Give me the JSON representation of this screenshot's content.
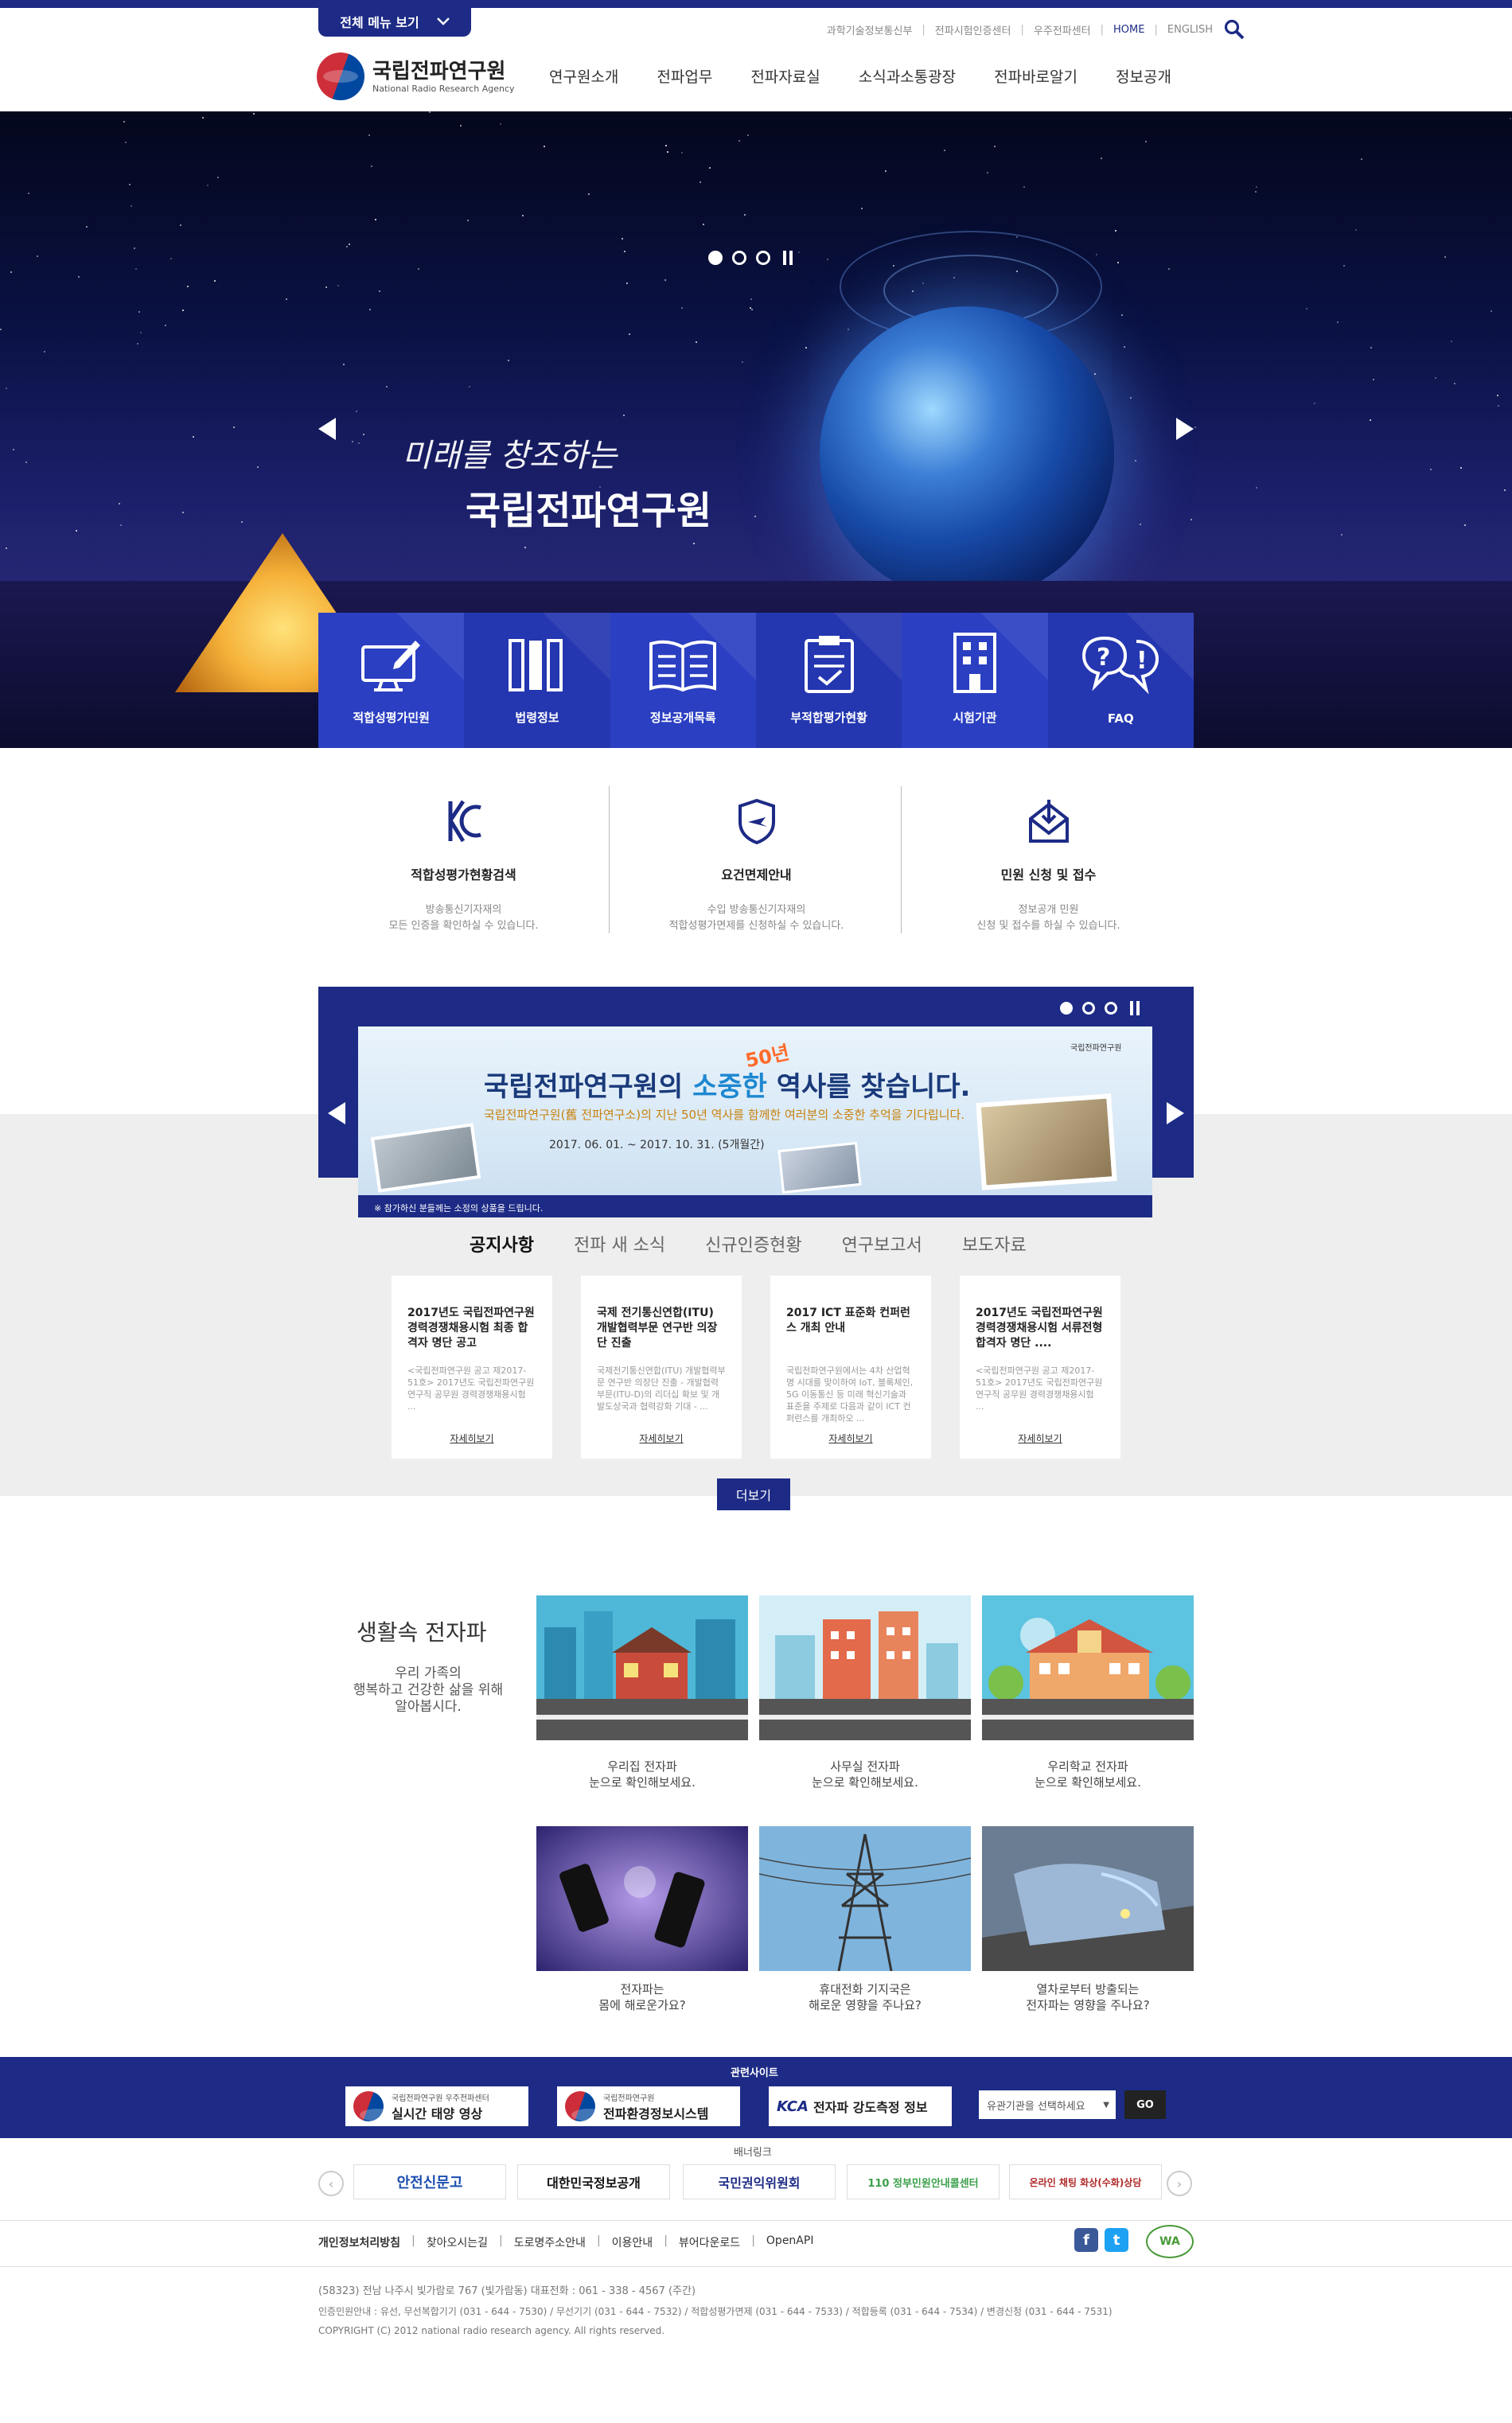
{
  "header": {
    "all_menu": "전체 메뉴 보기",
    "util_links": [
      "과학기술정보통신부",
      "전파시험인증센터",
      "우주전파센터",
      "HOME",
      "ENGLISH"
    ],
    "logo_ko": "국립전파연구원",
    "logo_en": "National Radio Research Agency",
    "gnb": [
      "연구원소개",
      "전파업무",
      "전파자료실",
      "소식과소통광장",
      "전파바로알기",
      "정보공개"
    ]
  },
  "hero": {
    "subtitle": "미래를 창조하는",
    "title": "국립전파연구원",
    "slides": 3,
    "active_slide": 1
  },
  "quick_links": [
    {
      "label": "적합성평가민원",
      "icon": "monitor-pen-icon",
      "color": "#2b3fc2"
    },
    {
      "label": "법령정보",
      "icon": "books-icon",
      "color": "#2436b0"
    },
    {
      "label": "정보공개목록",
      "icon": "open-book-icon",
      "color": "#2b3fc2"
    },
    {
      "label": "부적합평가현황",
      "icon": "clipboard-check-icon",
      "color": "#2436b0"
    },
    {
      "label": "시험기관",
      "icon": "building-icon",
      "color": "#2b3fc2"
    },
    {
      "label": "FAQ",
      "icon": "speech-bubbles-icon",
      "color": "#2436b0"
    }
  ],
  "services": [
    {
      "title": "적합성평가현황검색",
      "desc1": "방송통신기자재의",
      "desc2": "모든 인증을 확인하실 수 있습니다.",
      "icon": "kc-mark-icon"
    },
    {
      "title": "요건면제안내",
      "desc1": "수입 방송통신기자재의",
      "desc2": "적합성평가면제를 신청하실 수 있습니다.",
      "icon": "shield-plane-icon"
    },
    {
      "title": "민원 신청 및 접수",
      "desc1": "정보공개 민원",
      "desc2": "신청 및 접수를 하실 수 있습니다.",
      "icon": "mail-download-icon"
    }
  ],
  "banner": {
    "title_a": "국립전파연구원의 ",
    "title_hl": "소중한",
    "title_b": " 역사를 찾습니다.",
    "badge": "50년",
    "desc": "국립전파연구원(舊 전파연구소)의 지난 50년 역사를 함께한 여러분의 소중한 추억을 기다립니다.",
    "date": "2017. 06. 01. ~ 2017. 10. 31. (5개월간)",
    "note": "※ 참가하신 분들께는 소정의 상품을 드립니다.",
    "org": "국립전파연구원"
  },
  "notice": {
    "tabs": [
      "공지사항",
      "전파 새 소식",
      "신규인증현황",
      "연구보고서",
      "보도자료"
    ],
    "active_tab": 0,
    "cards": [
      {
        "title": "2017년도 국립전파연구원 경력경쟁채용시험 최종 합격자 명단 공고",
        "body": "<국립전파연구원 공고 제2017-51호> 2017년도 국립전파연구원 연구직 공무원 경력경쟁채용시험 ...",
        "more": "자세히보기"
      },
      {
        "title": "국제 전기통신연합(ITU) 개발협력부문 연구반 의장단 진출",
        "body": "국제전기통신연합(ITU) 개발협력부문 연구반 의장단 진출 - 개발협력부문(ITU-D)의 리더십 확보 및 개발도상국과 협력강화 기대 - ...",
        "more": "자세히보기"
      },
      {
        "title": "2017 ICT 표준화 컨퍼런스 개최 안내",
        "body": "국립전파연구원에서는 4차 산업혁명 시대를 맞이하여 IoT, 블록체인, 5G 이동통신 등 미래 혁신기술과 표준을 주제로 다음과 같이 ICT 컨퍼런스를 개최하오 ...",
        "more": "자세히보기"
      },
      {
        "title": "2017년도 국립전파연구원 경력경쟁채용시험 서류전형 합격자 명단 ....",
        "body": "<국립전파연구원 공고 제2017-51호> 2017년도 국립전파연구원 연구직 공무원 경력경쟁채용시험 ...",
        "more": "자세히보기"
      }
    ],
    "more_btn": "더보기"
  },
  "life": {
    "title": "생활속 전자파",
    "desc": [
      "우리 가족의",
      "행복하고 건강한 삶을 위해",
      "알아봅시다."
    ],
    "items": [
      {
        "cap1": "우리집 전자파",
        "cap2": "눈으로 확인해보세요."
      },
      {
        "cap1": "사무실 전자파",
        "cap2": "눈으로 확인해보세요."
      },
      {
        "cap1": "우리학교 전자파",
        "cap2": "눈으로 확인해보세요."
      },
      {
        "cap1": "전자파는",
        "cap2": "몸에 해로운가요?"
      },
      {
        "cap1": "휴대전화 기지국은",
        "cap2": "해로운 영향을 주나요?"
      },
      {
        "cap1": "열차로부터 방출되는",
        "cap2": "전자파는 영향을 주나요?"
      }
    ]
  },
  "related": {
    "title": "관련사이트",
    "sites": [
      {
        "t1": "국립전파연구원 우주전파센터",
        "t2": "실시간 태양 영상"
      },
      {
        "t1": "국립전파연구원",
        "t2": "전파환경정보시스템"
      },
      {
        "t1": "KCA",
        "t2": "전자파 강도측정 정보"
      }
    ],
    "select": "유관기관을 선택하세요",
    "go": "GO"
  },
  "banner_links": {
    "title": "배너링크",
    "items": [
      "안전신문고",
      "대한민국정보공개",
      "국민권익위원회",
      "110 정부민원안내콜센터",
      "온라인 채팅 화상(수화)상담"
    ]
  },
  "footer": {
    "links": [
      "개인정보처리방침",
      "찾아오시는길",
      "도로명주소안내",
      "이용안내",
      "뷰어다운로드",
      "OpenAPI"
    ],
    "addr1": "(58323) 전남 나주시 빛가람로 767 (빛가람동)      대표전화 : 061 - 338 - 4567 (주간)",
    "addr2": "인증민원안내 : 유선, 무선복합기기 (031 - 644 - 7530) / 무선기기 (031 - 644 - 7532) / 적합성평가면제 (031 - 644 - 7533) / 적합등록 (031 - 644 - 7534) / 변경신청 (031 - 644 - 7531)",
    "copy": "COPYRIGHT (C) 2012 national radio research agency. All rights reserved.",
    "wa": "WA"
  }
}
